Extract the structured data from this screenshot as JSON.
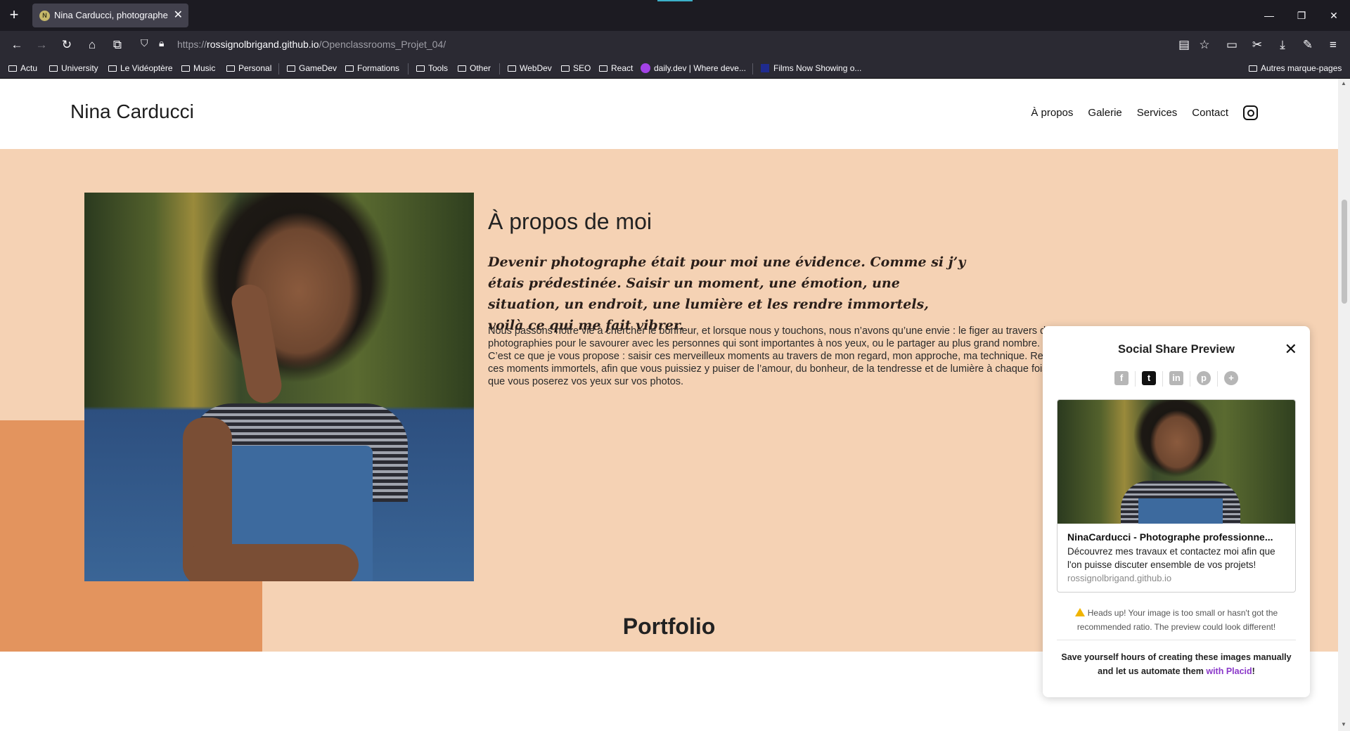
{
  "browser": {
    "tab_title": "Nina Carducci, photographe",
    "tab_favicon_letter": "N",
    "url_prefix": "https://",
    "url_host": "rossignolbrigand.github.io",
    "url_path": "/Openclassrooms_Projet_04/",
    "bookmarks": [
      "Actu",
      "University",
      "Le Vidéoptère",
      "Music",
      "Personal",
      "GameDev",
      "Formations",
      "Tools",
      "Other",
      "WebDev",
      "SEO",
      "React",
      "daily.dev | Where deve...",
      "Films Now Showing o..."
    ],
    "other_bookmarks": "Autres marque-pages"
  },
  "site": {
    "logo": "Nina Carducci",
    "nav": [
      "À propos",
      "Galerie",
      "Services",
      "Contact"
    ],
    "about": {
      "title": "À propos de moi",
      "quote": "Devenir photographe était pour moi une évidence. Comme si j’y étais prédestinée. Saisir un moment, une émotion, une situation, un endroit, une lumière et les rendre immortels, voilà ce qui me fait vibrer.",
      "text": "Nous passons notre vie à chercher le bonheur, et lorsque nous y touchons, nous n’avons qu’une envie : le figer au travers de photographies pour le savourer avec les personnes qui sont importantes à nos yeux, ou le partager au plus grand nombre. C’est ce que je vous propose : saisir ces merveilleux moments au travers de mon regard, mon approche, ma technique. Rendre ces moments immortels, afin que vous puissiez y puiser de l’amour, du bonheur, de la tendresse et de lumière à chaque fois que vous poserez vos yeux sur vos photos."
    },
    "portfolio_title": "Portfolio"
  },
  "share_popup": {
    "title": "Social Share Preview",
    "close": "✕",
    "card_title": "NinaCarducci - Photographe professionne...",
    "card_description": "Découvrez mes travaux et contactez moi afin que l'on puisse discuter ensemble de vos projets!",
    "card_domain": "rossignolbrigand.github.io",
    "warning": "Heads up! Your image is too small or hasn't got the recommended ratio. The preview could look different!",
    "promo_text": "Save yourself hours of creating these images manually and let us automate them ",
    "promo_link": "with Placid",
    "promo_end": "!"
  },
  "colors": {
    "about_bg": "#f5d2b4",
    "about_accent": "#e3945e",
    "placid_link": "#8a37c9",
    "tab_bg": "#42414d",
    "toolbar_bg": "#2b2a33"
  }
}
